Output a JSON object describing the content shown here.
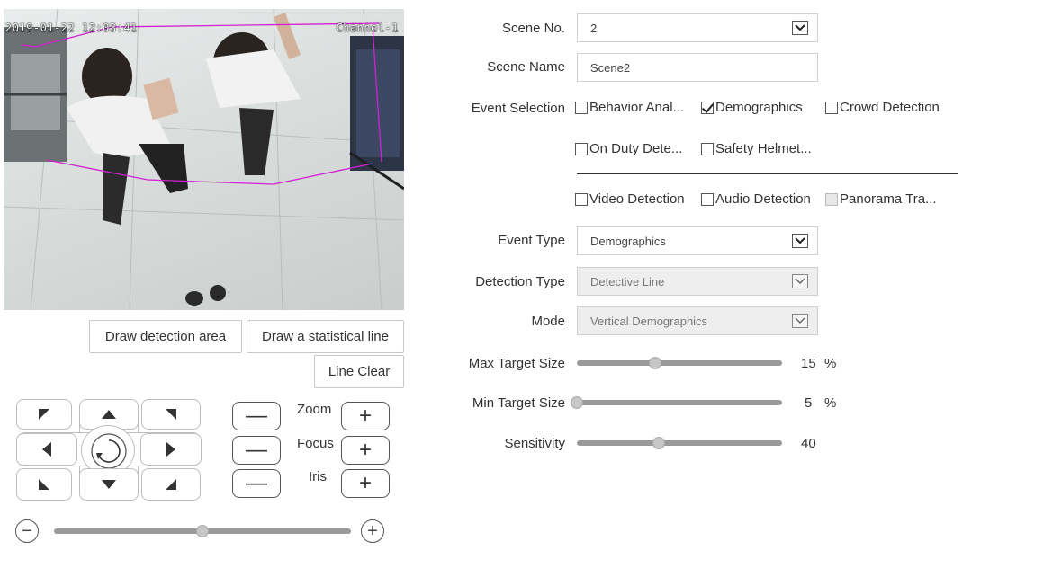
{
  "video": {
    "timestamp": "2019-01-22 12:03:41",
    "channel": "Channel-1"
  },
  "buttons": {
    "draw_area": "Draw detection area",
    "draw_line": "Draw a statistical line",
    "line_clear": "Line Clear"
  },
  "ptz": {
    "zoom_label": "Zoom",
    "focus_label": "Focus",
    "iris_label": "Iris",
    "minus": "—",
    "plus": "+",
    "speed_minus": "−",
    "speed_plus": "+",
    "speed_level": 0.5
  },
  "form": {
    "scene_no": {
      "label": "Scene No.",
      "value": "2"
    },
    "scene_name": {
      "label": "Scene Name",
      "value": "Scene2"
    },
    "event_selection": {
      "label": "Event Selection",
      "options": [
        {
          "label": "Behavior Anal...",
          "checked": false
        },
        {
          "label": "Demographics",
          "checked": true
        },
        {
          "label": "Crowd Detection",
          "checked": false
        },
        {
          "label": "On Duty Dete...",
          "checked": false
        },
        {
          "label": "Safety Helmet...",
          "checked": false
        },
        {
          "label": "Video Detection",
          "checked": false
        },
        {
          "label": "Audio Detection",
          "checked": false
        },
        {
          "label": "Panorama Tra...",
          "checked": false,
          "disabled": true
        }
      ]
    },
    "event_type": {
      "label": "Event Type",
      "value": "Demographics"
    },
    "detection_type": {
      "label": "Detection Type",
      "value": "Detective Line"
    },
    "mode": {
      "label": "Mode",
      "value": "Vertical Demographics"
    },
    "max_target": {
      "label": "Max Target Size",
      "value": "15",
      "unit": "%",
      "level": 0.38
    },
    "min_target": {
      "label": "Min Target Size",
      "value": "5",
      "unit": "%",
      "level": 0.0
    },
    "sensitivity": {
      "label": "Sensitivity",
      "value": "40",
      "level": 0.4
    }
  },
  "colors": {
    "overlay_line": "#d21fd2",
    "slider_track": "#9a9a9a",
    "knob": "#c6c6c6"
  }
}
